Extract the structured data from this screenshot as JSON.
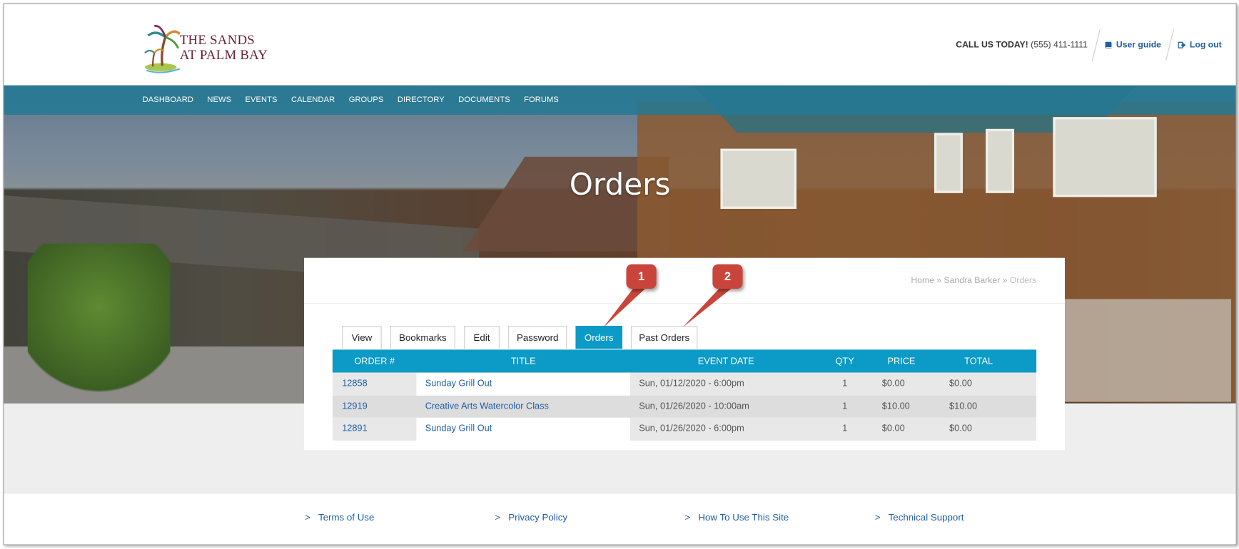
{
  "site": {
    "logo_line1": "THE SANDS",
    "logo_line2": "AT PALM BAY"
  },
  "header": {
    "call_label": "CALL US TODAY!",
    "phone": "(555) 411-1111",
    "user_guide": "User guide",
    "logout": "Log out",
    "icons": {
      "user_guide": "book-icon",
      "logout": "sign-out-icon"
    }
  },
  "nav": {
    "items": [
      "DASHBOARD",
      "NEWS",
      "EVENTS",
      "CALENDAR",
      "GROUPS",
      "DIRECTORY",
      "DOCUMENTS",
      "FORUMS"
    ]
  },
  "page": {
    "title": "Orders"
  },
  "breadcrumb": {
    "home": "Home",
    "sep": "»",
    "user": "Sandra Barker",
    "current": "Orders"
  },
  "tabs": [
    {
      "label": "View",
      "active": false
    },
    {
      "label": "Bookmarks",
      "active": false
    },
    {
      "label": "Edit",
      "active": false
    },
    {
      "label": "Password",
      "active": false
    },
    {
      "label": "Orders",
      "active": true
    },
    {
      "label": "Past Orders",
      "active": false
    }
  ],
  "table": {
    "headers": [
      "ORDER #",
      "TITLE",
      "EVENT DATE",
      "QTY",
      "PRICE",
      "TOTAL"
    ],
    "rows": [
      {
        "order": "12858",
        "title": "Sunday Grill Out",
        "date": "Sun, 01/12/2020 - 6:00pm",
        "qty": "1",
        "price": "$0.00",
        "total": "$0.00"
      },
      {
        "order": "12919",
        "title": "Creative Arts Watercolor Class",
        "date": "Sun, 01/26/2020 - 10:00am",
        "qty": "1",
        "price": "$10.00",
        "total": "$10.00"
      },
      {
        "order": "12891",
        "title": "Sunday Grill Out",
        "date": "Sun, 01/26/2020 - 6:00pm",
        "qty": "1",
        "price": "$0.00",
        "total": "$0.00"
      }
    ]
  },
  "callouts": [
    "1",
    "2"
  ],
  "footer": {
    "chevron": ">",
    "links": [
      "Terms of Use",
      "Privacy Policy",
      "How To Use This Site",
      "Technical Support"
    ]
  },
  "colors": {
    "accent": "#0c9ac6",
    "nav": "#227994",
    "link": "#1f5ea8",
    "callout": "#c9453b",
    "logo_text": "#6b1f2f"
  }
}
